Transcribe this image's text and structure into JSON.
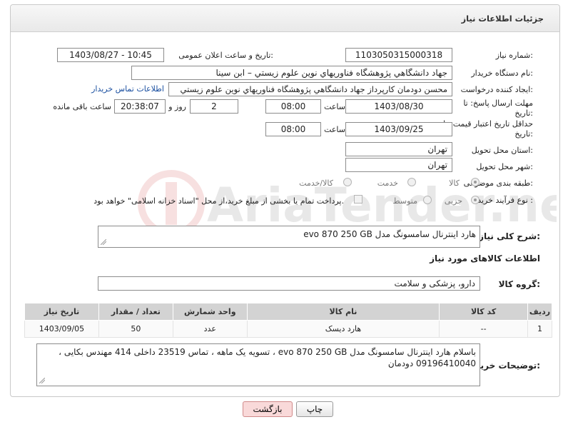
{
  "header": {
    "title": "جزئیات اطلاعات نیاز"
  },
  "fields": {
    "need_number": {
      "label": "شماره نیاز:",
      "value": "1103050315000318"
    },
    "announce_datetime": {
      "label": "تاریخ و ساعت اعلان عمومی:",
      "value": "1403/08/27 - 10:45"
    },
    "buyer_org": {
      "label": "نام دستگاه خریدار:",
      "value": "جهاد دانشگاهي پژوهشگاه فناوريهاي نوين علوم زيستي – ابن سينا"
    },
    "requester": {
      "label": "ایجاد کننده درخواست:",
      "value": "محسن دودمان كارپرداز جهاد دانشگاهي پژوهشگاه فناوريهاي نوين علوم زيستي",
      "contact_link": "اطلاعات تماس خریدار"
    },
    "reply_deadline": {
      "label_line1": "مهلت ارسال پاسخ: تا",
      "label_line2": "تاریخ:",
      "date": "1403/08/30",
      "time_label": "ساعت",
      "time": "08:00",
      "days": "2",
      "days_label": "روز و",
      "remaining": "20:38:07",
      "remaining_label": "ساعت باقی مانده"
    },
    "price_validity": {
      "label_line1": "حداقل تاریخ اعتبار قیمت: تا",
      "label_line2": "تاریخ:",
      "date": "1403/09/25",
      "time_label": "ساعت",
      "time": "08:00"
    },
    "delivery_province": {
      "label": "استان محل تحویل:",
      "value": "تهران"
    },
    "delivery_city": {
      "label": "شهر محل تحویل:",
      "value": "تهران"
    },
    "category": {
      "label": "طبقه بندی موضوعی:",
      "options": [
        "کالا",
        "خدمت",
        "کالا/خدمت"
      ],
      "selected": "کالا"
    },
    "purchase_process": {
      "label": "نوع فرآیند خرید :",
      "options": [
        "جزیی",
        "متوسط"
      ],
      "selected": "جزیی",
      "payment_note": "پرداخت تمام یا بخشی از مبلغ خرید،از محل \"اسناد خزانه اسلامی\" خواهد بود."
    }
  },
  "summary": {
    "label": "شرح کلی نیاز:",
    "value": "هارد اينترنال سامسونگ مدل evo 870 250 GB"
  },
  "goods_section": {
    "title": "اطلاعات کالاهای مورد نیاز"
  },
  "goods_group": {
    "label": "گروه کالا:",
    "value": "دارو، پزشکی و سلامت"
  },
  "table": {
    "headers": [
      "ردیف",
      "کد کالا",
      "نام کالا",
      "واحد شمارش",
      "تعداد / مقدار",
      "تاریخ نیاز"
    ],
    "rows": [
      [
        "1",
        "--",
        "هارد ديسک",
        "عدد",
        "50",
        "1403/09/05"
      ]
    ]
  },
  "buyer_notes": {
    "label": "توضیحات خریدار:",
    "value": "باسلام هارد اينترنال سامسونگ مدل evo 870 250 GB ، تسويه يک ماهه ، تماس 23519 داخلی 414 مهندس بکايی ، 09196410040 دودمان"
  },
  "buttons": {
    "print": "چاپ",
    "back": "بازگشت"
  },
  "watermark": {
    "text": "AriaTender.neT"
  },
  "colors": {
    "link": "#1a4fa0",
    "back_button": "#f9d9d9",
    "table_header": "#d3d3d3"
  }
}
